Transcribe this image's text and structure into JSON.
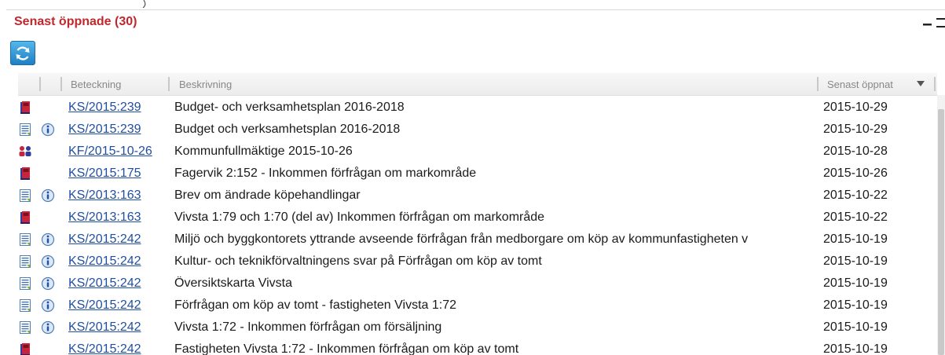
{
  "panel": {
    "title": "Senast öppnade (30)"
  },
  "toolbar": {
    "refresh_icon": "refresh-icon"
  },
  "grid": {
    "columns": {
      "beteckning": "Beteckning",
      "beskrivning": "Beskrivning",
      "senast_oppnat": "Senast öppnat"
    },
    "sort": {
      "column": "senast_oppnat",
      "direction": "descending"
    },
    "rows": [
      {
        "icon": "case-folder-icon",
        "info": false,
        "beteckning": "KS/2015:239",
        "beskrivning": "Budget- och verksamhetsplan 2016-2018",
        "datum": "2015-10-29"
      },
      {
        "icon": "document-icon",
        "info": true,
        "beteckning": "KS/2015:239",
        "beskrivning": "Budget och verksamhetsplan 2016-2018",
        "datum": "2015-10-29"
      },
      {
        "icon": "meeting-icon",
        "info": false,
        "beteckning": "KF/2015-10-26",
        "beskrivning": "Kommunfullmäktige 2015-10-26",
        "datum": "2015-10-28"
      },
      {
        "icon": "case-folder-icon",
        "info": false,
        "beteckning": "KS/2015:175",
        "beskrivning": "Fagervik 2:152 - Inkommen förfrågan om markområde",
        "datum": "2015-10-26"
      },
      {
        "icon": "document-icon",
        "info": true,
        "beteckning": "KS/2013:163",
        "beskrivning": "Brev om ändrade köpehandlingar",
        "datum": "2015-10-22"
      },
      {
        "icon": "case-folder-icon",
        "info": false,
        "beteckning": "KS/2013:163",
        "beskrivning": "Vivsta 1:79 och 1:70 (del av) Inkommen förfrågan om markområde",
        "datum": "2015-10-22"
      },
      {
        "icon": "document-icon",
        "info": true,
        "beteckning": "KS/2015:242",
        "beskrivning": "Miljö och byggkontorets yttrande avseende förfrågan från medborgare om köp av kommunfastigheten v",
        "datum": "2015-10-19"
      },
      {
        "icon": "document-icon",
        "info": true,
        "beteckning": "KS/2015:242",
        "beskrivning": "Kultur- och teknikförvaltningens svar på Förfrågan om köp av tomt",
        "datum": "2015-10-19"
      },
      {
        "icon": "document-icon",
        "info": true,
        "beteckning": "KS/2015:242",
        "beskrivning": "Översiktskarta Vivsta",
        "datum": "2015-10-19"
      },
      {
        "icon": "document-icon",
        "info": true,
        "beteckning": "KS/2015:242",
        "beskrivning": "Förfrågan om köp av tomt - fastigheten Vivsta 1:72",
        "datum": "2015-10-19"
      },
      {
        "icon": "document-icon",
        "info": true,
        "beteckning": "KS/2015:242",
        "beskrivning": "Vivsta 1:72 - Inkommen förfrågan om försäljning",
        "datum": "2015-10-19"
      },
      {
        "icon": "case-folder-icon",
        "info": false,
        "beteckning": "KS/2015:242",
        "beskrivning": "Fastigheten Vivsta 1:72 - Inkommen förfrågan om köp av tomt",
        "datum": "2015-10-19"
      }
    ]
  },
  "colors": {
    "title": "#c0282d",
    "link": "#1f4fa0",
    "refresh_button": "#2a8fd4"
  }
}
